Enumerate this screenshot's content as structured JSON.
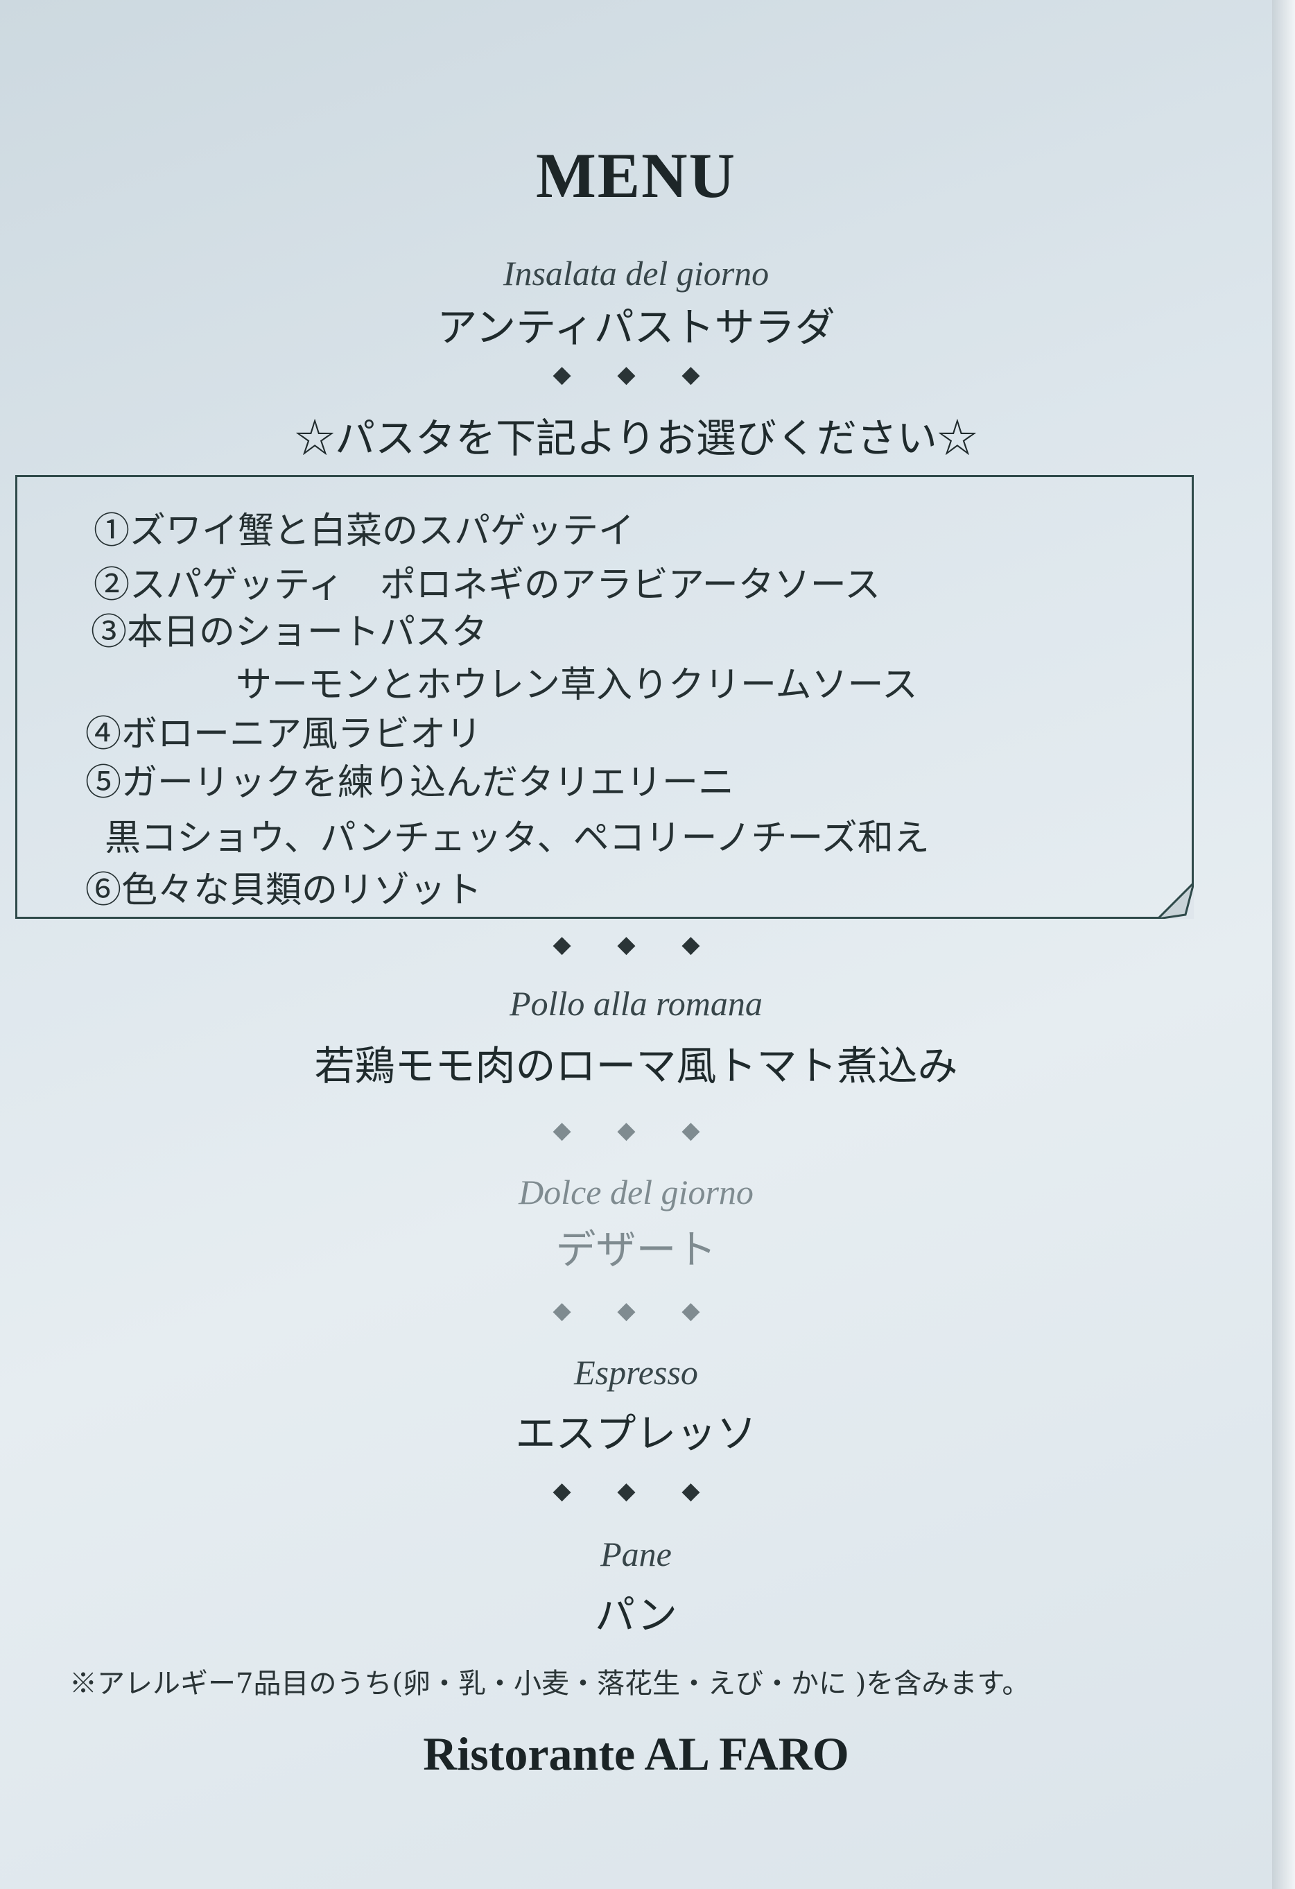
{
  "menu": {
    "title": "MENU",
    "antipasto": {
      "it": "Insalata del giorno",
      "jp": "アンティパストサラダ"
    },
    "separator": "◆ ◆ ◆",
    "pasta_heading": "☆パスタを下記よりお選びください☆",
    "pasta_items": [
      "①ズワイ蟹と白菜のスパゲッテイ",
      "②スパゲッティ　ポロネギのアラビアータソース",
      "③本日のショートパスタ",
      "サーモンとホウレン草入りクリームソース",
      "④ボローニア風ラビオリ",
      "⑤ガーリックを練り込んだタリエリーニ",
      "黒コショウ、パンチェッタ、ペコリーノチーズ和え",
      "⑥色々な貝類のリゾット"
    ],
    "main": {
      "it": "Pollo alla romana",
      "jp": "若鶏モモ肉のローマ風トマト煮込み"
    },
    "dessert": {
      "it": "Dolce del giorno",
      "jp": "デザート"
    },
    "coffee": {
      "it": "Espresso",
      "jp": "エスプレッソ"
    },
    "bread": {
      "it": "Pane",
      "jp": "パン"
    },
    "allergy_note": "※アレルギー7品目のうち(卵・乳・小麦・落花生・えび・かに )を含みます。",
    "restaurant": "Ristorante AL FARO"
  }
}
